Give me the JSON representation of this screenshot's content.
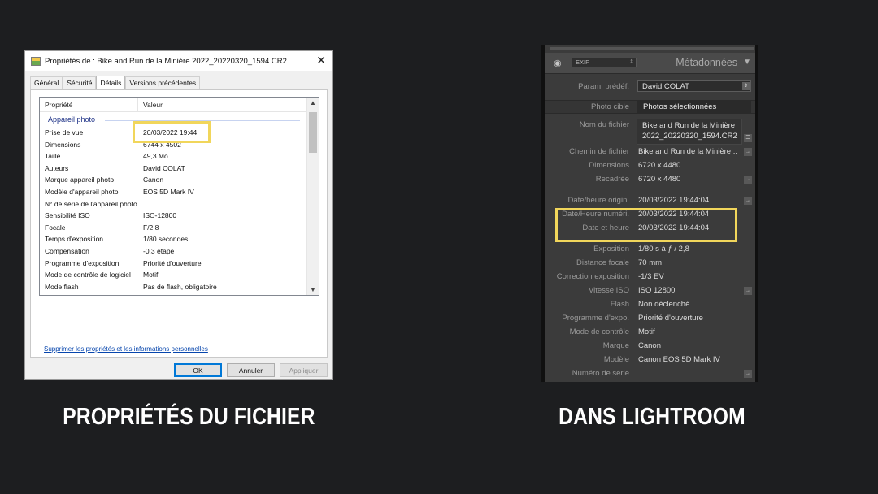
{
  "windows_dialog": {
    "title": "Propriétés de : Bike and Run de la Minière 2022_20220320_1594.CR2",
    "close_glyph": "✕",
    "tabs": [
      "Général",
      "Sécurité",
      "Détails",
      "Versions précédentes"
    ],
    "active_tab": "Détails",
    "columns": [
      "Propriété",
      "Valeur"
    ],
    "group_label": "Appareil photo",
    "rows": [
      {
        "name": "Prise de vue",
        "value": "20/03/2022 19:44"
      },
      {
        "name": "Dimensions",
        "value": "6744 x 4502"
      },
      {
        "name": "Taille",
        "value": "49,3 Mo"
      },
      {
        "name": "Auteurs",
        "value": "David COLAT"
      },
      {
        "name": "Marque appareil photo",
        "value": "Canon"
      },
      {
        "name": "Modèle d'appareil photo",
        "value": "EOS 5D Mark IV"
      },
      {
        "name": "N° de série de l'appareil photo",
        "value": ""
      },
      {
        "name": "Sensibilité ISO",
        "value": "ISO-12800"
      },
      {
        "name": "Focale",
        "value": "F/2.8"
      },
      {
        "name": "Temps d'exposition",
        "value": "1/80 secondes"
      },
      {
        "name": "Compensation",
        "value": "-0.3 étape"
      },
      {
        "name": "Programme d'exposition",
        "value": "Priorité d'ouverture"
      },
      {
        "name": "Mode de contrôle de logiciel",
        "value": "Motif"
      },
      {
        "name": "Mode flash",
        "value": "Pas de flash, obligatoire"
      }
    ],
    "remove_link": "Supprimer les propriétés et les informations personnelles",
    "buttons": {
      "ok": "OK",
      "cancel": "Annuler",
      "apply": "Appliquer"
    }
  },
  "lightroom": {
    "panel_title": "Métadonnées",
    "metadata_set": "EXIF",
    "preset_label": "Param. prédéf.",
    "preset_value": "David COLAT",
    "target_label": "Photo cible",
    "target_value": "Photos sélectionnées",
    "filename_label": "Nom du fichier",
    "filename_line1": "Bike and Run de la Minière",
    "filename_line2": "2022_20220320_1594.CR2",
    "fields": [
      {
        "label": "Chemin de fichier",
        "value": "Bike and Run de la Minière..."
      },
      {
        "label": "Dimensions",
        "value": "6720 x 4480"
      },
      {
        "label": "Recadrée",
        "value": "6720 x 4480"
      },
      {
        "label": "Date/heure origin.",
        "value": "20/03/2022 19:44:04"
      },
      {
        "label": "Date/Heure numéri.",
        "value": "20/03/2022 19:44:04"
      },
      {
        "label": "Date et heure",
        "value": "20/03/2022 19:44:04"
      },
      {
        "label": "Exposition",
        "value": "1/80 s à ƒ / 2,8"
      },
      {
        "label": "Distance focale",
        "value": "70 mm"
      },
      {
        "label": "Correction exposition",
        "value": "-1/3 EV"
      },
      {
        "label": "Vitesse ISO",
        "value": "ISO 12800"
      },
      {
        "label": "Flash",
        "value": "Non déclenché"
      },
      {
        "label": "Programme d'expo.",
        "value": "Priorité d'ouverture"
      },
      {
        "label": "Mode de contrôle",
        "value": "Motif"
      },
      {
        "label": "Marque",
        "value": "Canon"
      },
      {
        "label": "Modèle",
        "value": "Canon EOS 5D Mark IV"
      },
      {
        "label": "Numéro de série",
        "value": ""
      }
    ]
  },
  "captions": {
    "left": "PROPRIÉTÉS DU FICHIER",
    "right": "DANS LIGHTROOM"
  },
  "colors": {
    "highlight": "#f1d65b",
    "background": "#1d1e20",
    "lightroom_panel": "#3b3b3b"
  }
}
